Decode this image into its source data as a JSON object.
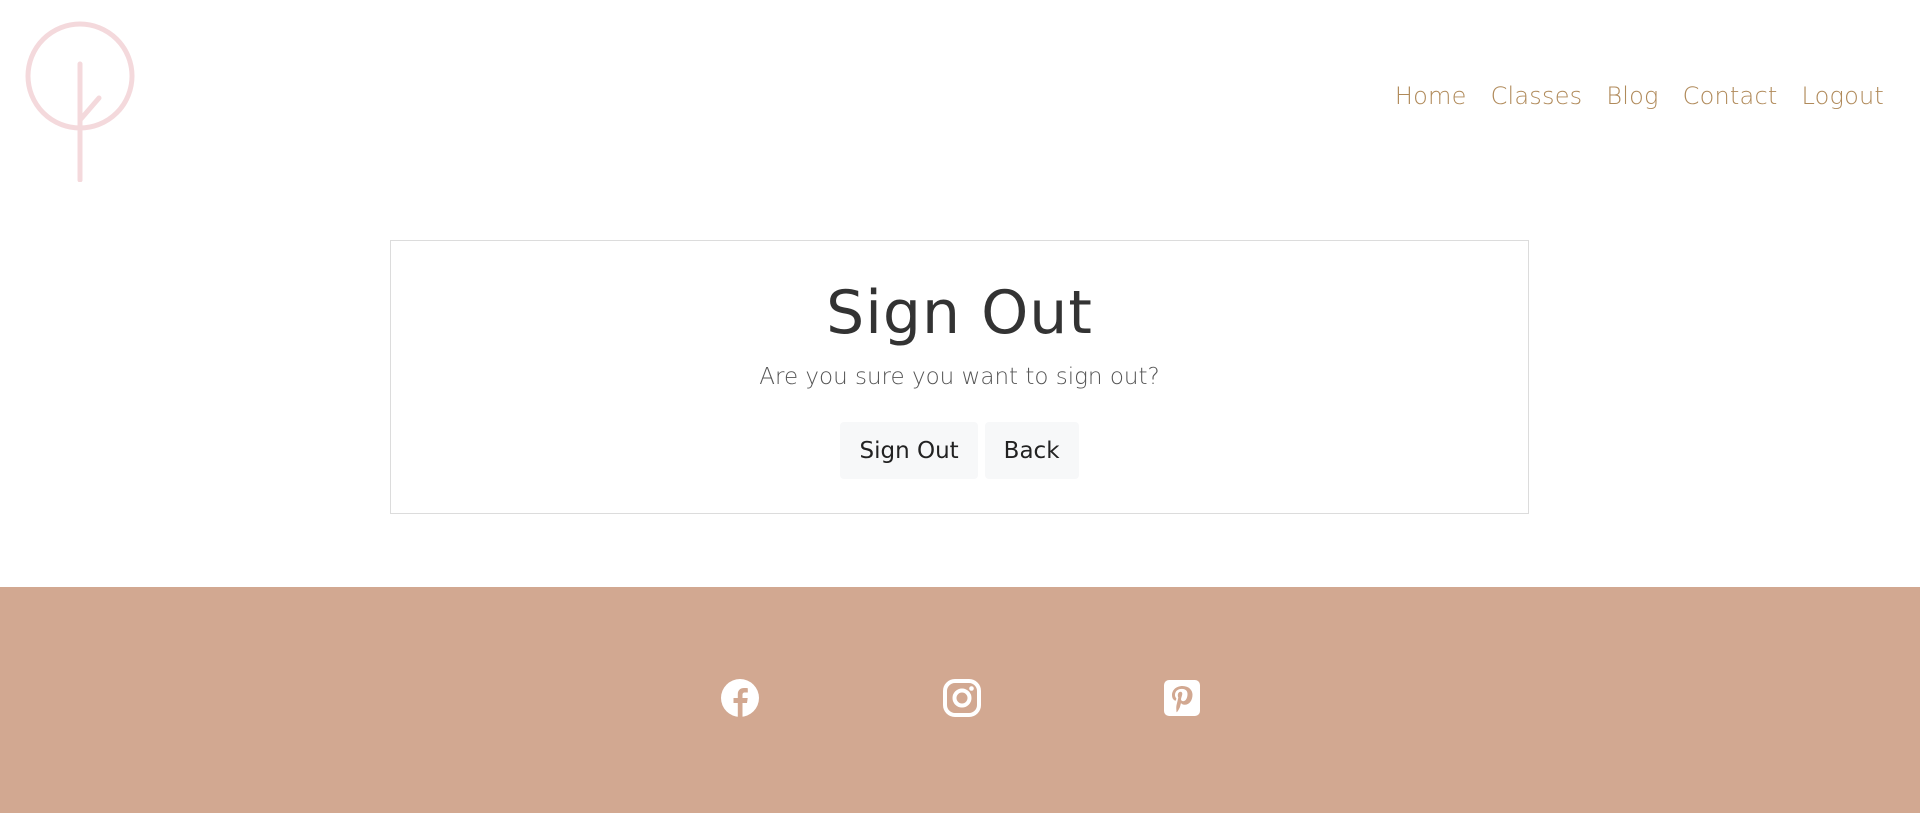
{
  "header": {
    "logo_icon": "tree-circle-logo",
    "nav": [
      {
        "label": "Home"
      },
      {
        "label": "Classes"
      },
      {
        "label": "Blog"
      },
      {
        "label": "Contact"
      },
      {
        "label": "Logout"
      }
    ]
  },
  "dialog": {
    "title": "Sign Out",
    "message": "Are you sure you want to sign out?",
    "sign_out_label": "Sign Out",
    "back_label": "Back"
  },
  "footer": {
    "social": [
      {
        "icon": "facebook-icon"
      },
      {
        "icon": "instagram-icon"
      },
      {
        "icon": "pinterest-icon"
      }
    ]
  },
  "colors": {
    "nav_link": "#b08a5a",
    "logo": "#f4d9dc",
    "footer_bg": "#d2a891",
    "card_border": "#dcdcdc",
    "button_bg": "#f7f8f9"
  }
}
